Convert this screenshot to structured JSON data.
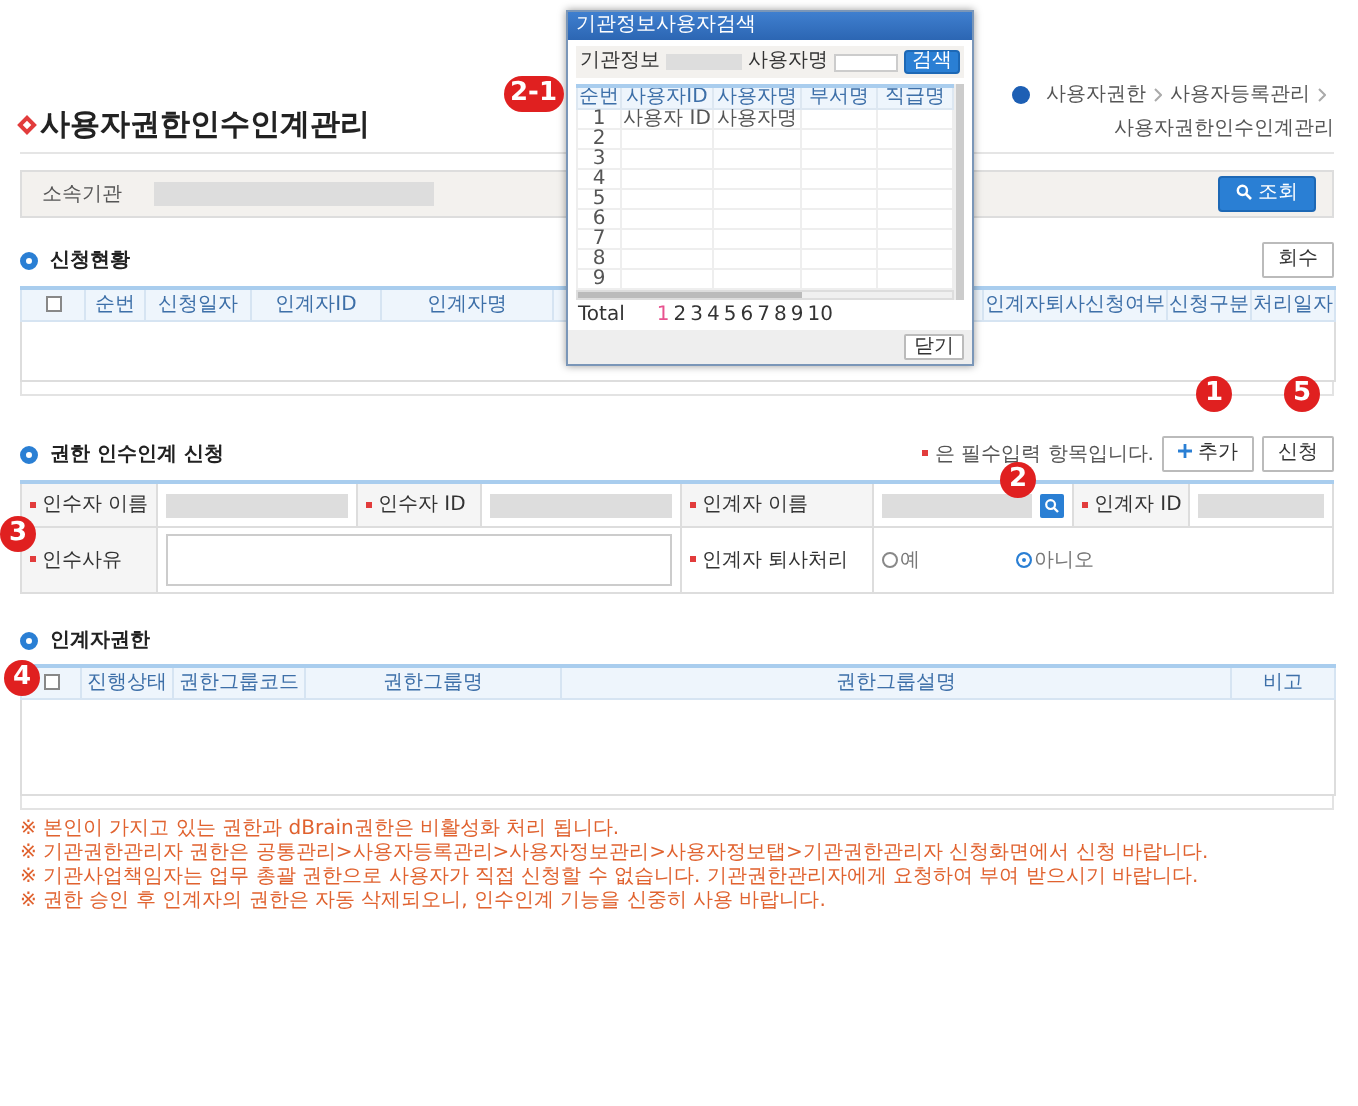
{
  "page_title": "사용자권한인수인계관리",
  "breadcrumb": [
    "사용자권한",
    "사용자등록관리",
    "사용자권한인수인계관리"
  ],
  "search": {
    "label": "소속기관",
    "button": "조회"
  },
  "requests": {
    "title": "신청현황",
    "button": "회수",
    "header_checkbox": {
      "checked": false
    },
    "columns": [
      "순번",
      "신청일자",
      "인계자ID",
      "인계자명",
      "",
      "인계자퇴사신청여부",
      "신청구분",
      "처리일자"
    ]
  },
  "handover_form": {
    "title": "권한 인수인계 신청",
    "required_note": "은 필수입력 항목입니다.",
    "add_button": "추가",
    "apply_button": "신청",
    "fields": [
      {
        "label": "인수자 이름",
        "required": true,
        "kind": "text"
      },
      {
        "label": "인수자 ID",
        "required": true,
        "kind": "text"
      },
      {
        "label": "인계자 이름",
        "required": true,
        "kind": "lookup"
      },
      {
        "label": "인계자 ID",
        "required": true,
        "kind": "text"
      }
    ],
    "reason": {
      "label": "인수사유",
      "required": true
    },
    "retire": {
      "label": "인계자 퇴사처리",
      "required": true,
      "options": [
        {
          "label": "예",
          "selected": false
        },
        {
          "label": "아니오",
          "selected": true
        }
      ]
    }
  },
  "rights": {
    "title": "인계자권한",
    "header_checkbox": {
      "checked": false
    },
    "columns": [
      "진행상태",
      "권한그룹코드",
      "권한그룹명",
      "권한그룹설명",
      "비고"
    ]
  },
  "notes": [
    "※ 본인이 가지고 있는 권한과 dBrain권한은 비활성화 처리 됩니다.",
    "※ 기관권한관리자 권한은 공통관리>사용자등록관리>사용자정보관리>사용자정보탭>기관권한관리자 신청화면에서 신청 바랍니다.",
    "※ 기관사업책임자는 업무 총괄 권한으로 사용자가 직접 신청할 수 없습니다. 기관권한관리자에게 요청하여 부여 받으시기 바랍니다.",
    "※ 권한 승인 후 인계자의 권한은 자동 삭제되오니, 인수인계 기능을 신중히 사용 바랍니다."
  ],
  "popup": {
    "title": "기관정보사용자검색",
    "org_label": "기관정보",
    "user_label": "사용자명",
    "search_button": "검색",
    "columns": [
      "순번",
      "사용자ID",
      "사용자명",
      "부서명",
      "직급명"
    ],
    "rows": [
      {
        "cells": [
          "1",
          "사용자 ID",
          "사용자명"
        ]
      },
      {
        "cells": [
          "2"
        ]
      },
      {
        "cells": [
          "3"
        ]
      },
      {
        "cells": [
          "4"
        ]
      },
      {
        "cells": [
          "5"
        ]
      },
      {
        "cells": [
          "6"
        ]
      },
      {
        "cells": [
          "7"
        ]
      },
      {
        "cells": [
          "8"
        ]
      },
      {
        "cells": [
          "9"
        ]
      }
    ],
    "total": "Total",
    "pages": [
      {
        "label": "1",
        "selected": true
      },
      {
        "label": "2",
        "selected": false
      },
      {
        "label": "3",
        "selected": false
      },
      {
        "label": "4",
        "selected": false
      },
      {
        "label": "5",
        "selected": false
      },
      {
        "label": "6",
        "selected": false
      },
      {
        "label": "7",
        "selected": false
      },
      {
        "label": "8",
        "selected": false
      },
      {
        "label": "9",
        "selected": false
      },
      {
        "label": "10",
        "selected": false
      }
    ],
    "close_button": "닫기"
  },
  "annotations": [
    {
      "label": "1",
      "kind": "add"
    },
    {
      "label": "5",
      "kind": "apply"
    },
    {
      "label": "2",
      "kind": "lookup"
    },
    {
      "label": "2-1",
      "kind": "popup"
    },
    {
      "label": "3",
      "kind": "form"
    },
    {
      "label": "4",
      "kind": "rights"
    }
  ]
}
